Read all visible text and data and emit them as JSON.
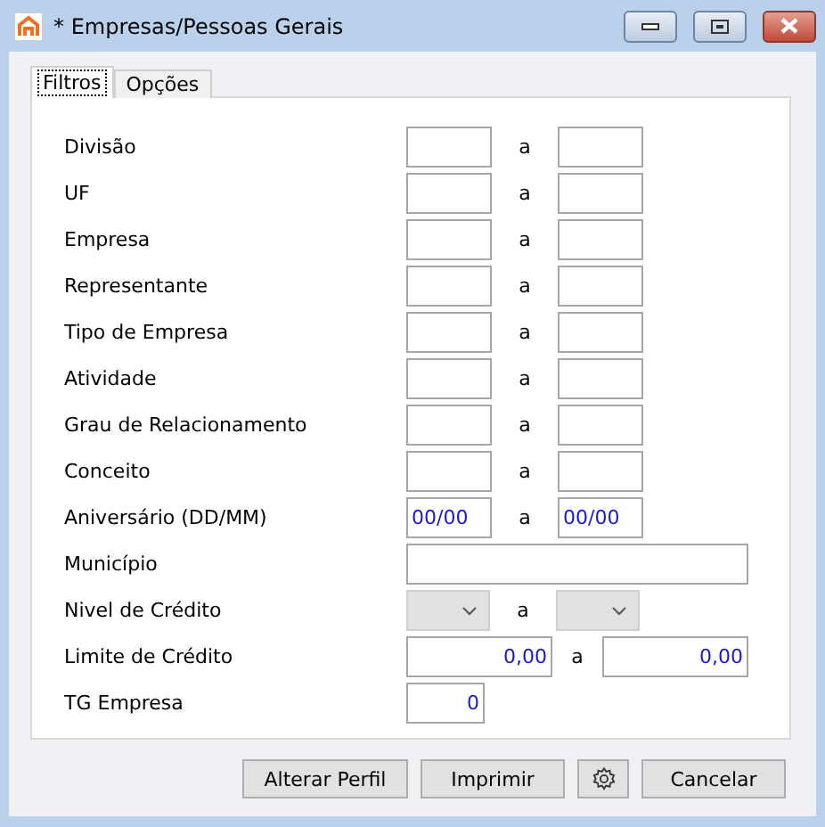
{
  "window": {
    "title": "* Empresas/Pessoas Gerais"
  },
  "tabs": [
    {
      "label": "Filtros",
      "selected": true
    },
    {
      "label": "Opções",
      "selected": false
    }
  ],
  "rows": [
    {
      "kind": "range",
      "label": "Divisão",
      "from": "",
      "separator": "a",
      "to": ""
    },
    {
      "kind": "range",
      "label": "UF",
      "from": "",
      "separator": "a",
      "to": ""
    },
    {
      "kind": "range",
      "label": "Empresa",
      "from": "",
      "separator": "a",
      "to": ""
    },
    {
      "kind": "range",
      "label": "Representante",
      "from": "",
      "separator": "a",
      "to": ""
    },
    {
      "kind": "range",
      "label": "Tipo de Empresa",
      "from": "",
      "separator": "a",
      "to": ""
    },
    {
      "kind": "range",
      "label": "Atividade",
      "from": "",
      "separator": "a",
      "to": ""
    },
    {
      "kind": "range",
      "label": "Grau de Relacionamento",
      "from": "",
      "separator": "a",
      "to": ""
    },
    {
      "kind": "range",
      "label": "Conceito",
      "from": "",
      "separator": "a",
      "to": ""
    },
    {
      "kind": "range",
      "label": "Aniversário (DD/MM)",
      "from": "00/00",
      "separator": "a",
      "to": "00/00"
    },
    {
      "kind": "text",
      "label": "Município",
      "value": ""
    },
    {
      "kind": "select",
      "label": "Nivel de Crédito",
      "from": "",
      "separator": "a",
      "to": ""
    },
    {
      "kind": "wide",
      "label": "Limite de Crédito",
      "from": "0,00",
      "separator": "a",
      "to": "0,00"
    },
    {
      "kind": "single",
      "label": "TG Empresa",
      "value": "0"
    }
  ],
  "buttons": [
    {
      "kind": "text",
      "label": "Alterar Perfil"
    },
    {
      "kind": "text",
      "label": "Imprimir"
    },
    {
      "kind": "icon"
    },
    {
      "kind": "text",
      "label": "Cancelar"
    }
  ]
}
